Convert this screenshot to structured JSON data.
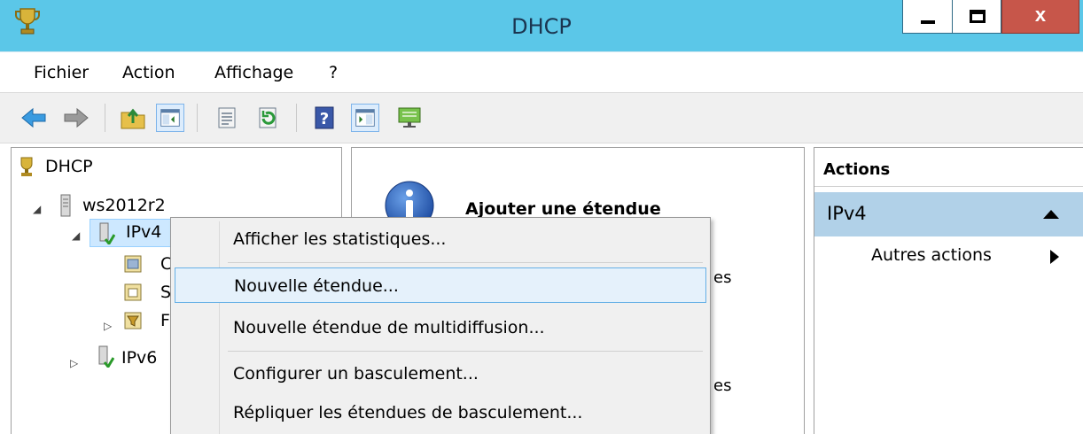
{
  "window": {
    "title": "DHCP",
    "close_glyph": "x"
  },
  "menubar": [
    "Fichier",
    "Action",
    "Affichage",
    "?"
  ],
  "toolbar": [
    {
      "icon": "back-arrow-icon"
    },
    {
      "icon": "forward-arrow-icon"
    },
    {
      "icon": "up-folder-icon"
    },
    {
      "icon": "show-hide-console-tree-icon",
      "active": true
    },
    {
      "icon": "properties-icon"
    },
    {
      "icon": "refresh-icon"
    },
    {
      "icon": "help-icon"
    },
    {
      "icon": "show-hide-action-pane-icon",
      "active": true
    },
    {
      "icon": "monitor-icon"
    }
  ],
  "tree": {
    "root": "DHCP",
    "server": "ws2012r2",
    "ipv4": "IPv4",
    "child_fragments": [
      "C",
      "S",
      "F"
    ],
    "ipv6": "IPv6"
  },
  "center": {
    "title": "Ajouter une étendue",
    "fragments": [
      "es",
      "es"
    ]
  },
  "actions": {
    "header": "Actions",
    "section": "IPv4",
    "more": "Autres actions"
  },
  "context_menu": {
    "items": [
      "Afficher les statistiques...",
      "Nouvelle étendue...",
      "Nouvelle étendue de multidiffusion...",
      "Configurer un basculement...",
      "Répliquer les étendues de basculement..."
    ],
    "highlighted_index": 1
  },
  "colors": {
    "titlebar": "#5bc7e8",
    "close_button": "#c7564a",
    "selection": "#cde8ff",
    "menu_highlight": "#e5f1fb",
    "actions_section": "#b1d1e8"
  }
}
